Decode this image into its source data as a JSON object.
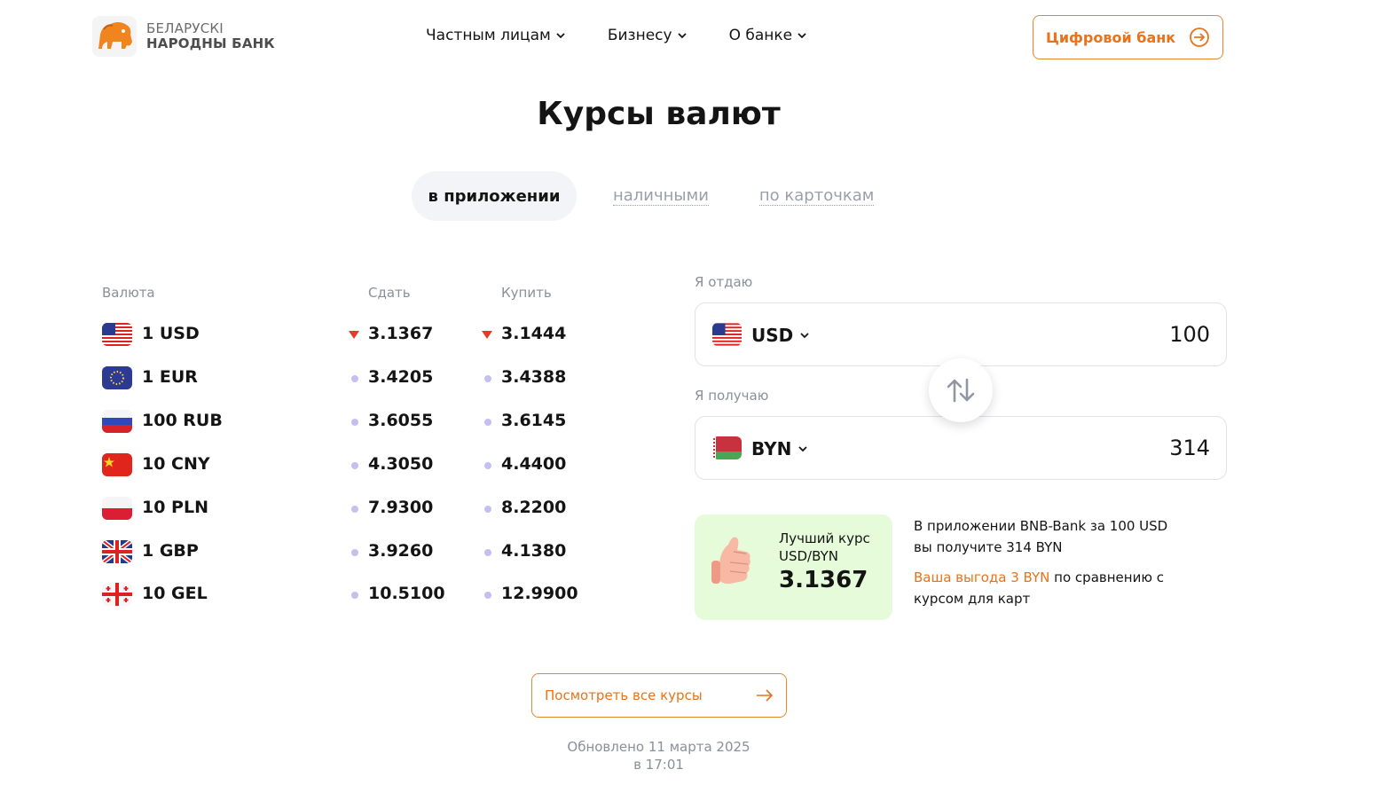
{
  "brand": {
    "line1": "БЕЛАРУСКІ",
    "line2": "НАРОДНЫ БАНК",
    "logo_icon": "lion-logo-icon",
    "accent_color": "#e8731a"
  },
  "nav": {
    "items": [
      {
        "label": "Частным лицам"
      },
      {
        "label": "Бизнесу"
      },
      {
        "label": "О банке"
      }
    ],
    "digital_bank_label": "Цифровой банк"
  },
  "page_title": "Курсы валют",
  "tabs": [
    {
      "label": "в приложении",
      "active": true
    },
    {
      "label": "наличными",
      "active": false
    },
    {
      "label": "по карточкам",
      "active": false
    }
  ],
  "rates": {
    "headers": {
      "currency": "Валюта",
      "sell": "Сдать",
      "buy": "Купить"
    },
    "rows": [
      {
        "currency": "1 USD",
        "flag": "us-flag",
        "sell": "3.1367",
        "buy": "3.1444",
        "sell_trend": "down",
        "buy_trend": "down"
      },
      {
        "currency": "1 EUR",
        "flag": "eu-flag",
        "sell": "3.4205",
        "buy": "3.4388",
        "sell_trend": "flat",
        "buy_trend": "flat"
      },
      {
        "currency": "100 RUB",
        "flag": "ru-flag",
        "sell": "3.6055",
        "buy": "3.6145",
        "sell_trend": "flat",
        "buy_trend": "flat"
      },
      {
        "currency": "10 CNY",
        "flag": "cn-flag",
        "sell": "4.3050",
        "buy": "4.4400",
        "sell_trend": "flat",
        "buy_trend": "flat"
      },
      {
        "currency": "10 PLN",
        "flag": "pl-flag",
        "sell": "7.9300",
        "buy": "8.2200",
        "sell_trend": "flat",
        "buy_trend": "flat"
      },
      {
        "currency": "1 GBP",
        "flag": "gb-flag",
        "sell": "3.9260",
        "buy": "4.1380",
        "sell_trend": "flat",
        "buy_trend": "flat"
      },
      {
        "currency": "10 GEL",
        "flag": "ge-flag",
        "sell": "10.5100",
        "buy": "12.9900",
        "sell_trend": "flat",
        "buy_trend": "flat"
      }
    ]
  },
  "converter": {
    "give_label": "Я отдаю",
    "give_currency": "USD",
    "give_amount": "100",
    "get_label": "Я получаю",
    "get_currency": "BYN",
    "get_amount": "314"
  },
  "best_rate": {
    "label": "Лучший курс USD/BYN",
    "value": "3.1367",
    "icon": "thumbs-up-icon"
  },
  "info": {
    "text1": "В приложении BNB-Bank за 100 USD вы получите 314 BYN",
    "accent": "Ваша выгода 3 BYN",
    "text2": " по сравнению с курсом для карт"
  },
  "view_all_label": "Посмотреть все курсы",
  "updated": {
    "line1": "Обновлено 11 марта 2025",
    "line2": "в 17:01"
  }
}
